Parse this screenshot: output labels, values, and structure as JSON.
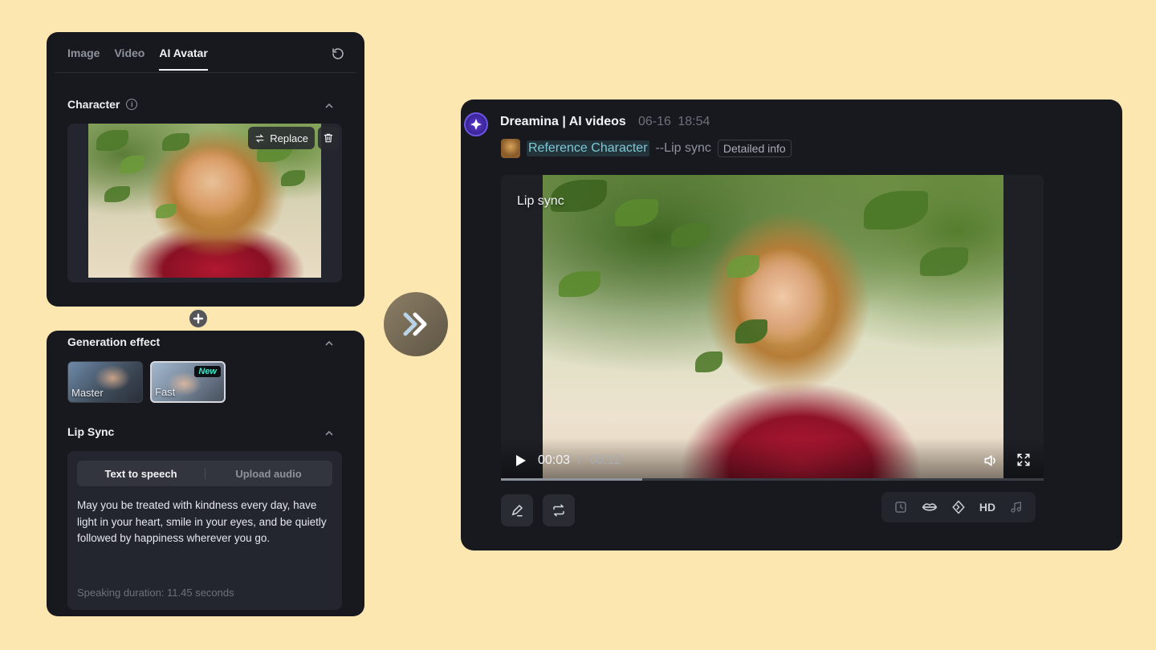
{
  "left_top": {
    "tabs": [
      {
        "label": "Image",
        "active": false
      },
      {
        "label": "Video",
        "active": false
      },
      {
        "label": "AI Avatar",
        "active": true
      }
    ],
    "character": {
      "title": "Character",
      "replace_label": "Replace"
    }
  },
  "left_bottom": {
    "generation_effect": {
      "title": "Generation effect",
      "options": [
        {
          "label": "Master",
          "selected": false
        },
        {
          "label": "Fast",
          "selected": true,
          "badge": "New"
        }
      ]
    },
    "lip_sync": {
      "title": "Lip Sync",
      "modes": [
        {
          "label": "Text to speech",
          "active": true
        },
        {
          "label": "Upload audio",
          "active": false
        }
      ],
      "text": "May you be treated with kindness every day, have light in your heart, smile in your eyes, and be quietly followed by happiness wherever you go.",
      "duration": "Speaking duration: 11.45 seconds"
    }
  },
  "result": {
    "app_title": "Dreamina | AI videos",
    "date": "06-16",
    "time": "18:54",
    "reference_label": "Reference Character",
    "mode_label": "--Lip sync",
    "detail_label": "Detailed info",
    "video": {
      "overlay_label": "Lip sync",
      "current_time": "00:03",
      "separator": "/",
      "total_time": "00:12",
      "progress_fraction": 0.26
    },
    "tools": [
      "clock-icon",
      "lips-icon",
      "diamond-icon",
      "HD",
      "music-icon"
    ],
    "hd_label": "HD"
  },
  "colors": {
    "background": "#fde7b1",
    "panel": "#17191f",
    "accent_teal": "#7ec8d8",
    "badge_teal": "#3ee6c9",
    "logo_purple": "#5a3ad1"
  }
}
